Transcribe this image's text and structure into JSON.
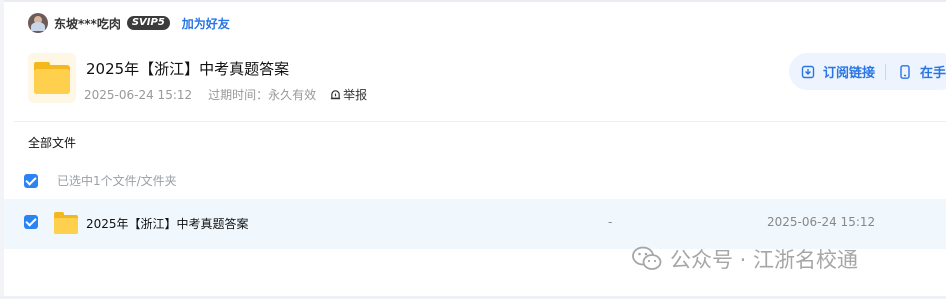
{
  "user": {
    "name": "东坡***吃肉",
    "vip_badge": "SVIP5",
    "add_friend_label": "加为好友"
  },
  "share": {
    "title": "2025年【浙江】中考真题答案",
    "date": "2025-06-24 15:12",
    "expiry": "过期时间：永久有效",
    "report_label": "举报"
  },
  "actions": {
    "subscribe_label": "订阅链接",
    "phone_label": "在手"
  },
  "breadcrumb": "全部文件",
  "selection": {
    "summary": "已选中1个文件/文件夹"
  },
  "files": [
    {
      "name": "2025年【浙江】中考真题答案",
      "size": "-",
      "modified": "2025-06-24 15:12",
      "selected": true
    }
  ],
  "watermark": "公众号 · 江浙名校通",
  "colors": {
    "accent": "#2a75e6",
    "checkbox": "#2a85f3",
    "folder": "#ffd04d",
    "row_selected_bg": "#f1f8fd",
    "actions_bg": "#edf4fe"
  },
  "icons": {
    "subscribe": "subscribe-icon",
    "phone": "phone-icon",
    "report": "alert-icon",
    "folder": "folder-icon",
    "watermark": "wechat-icon"
  }
}
